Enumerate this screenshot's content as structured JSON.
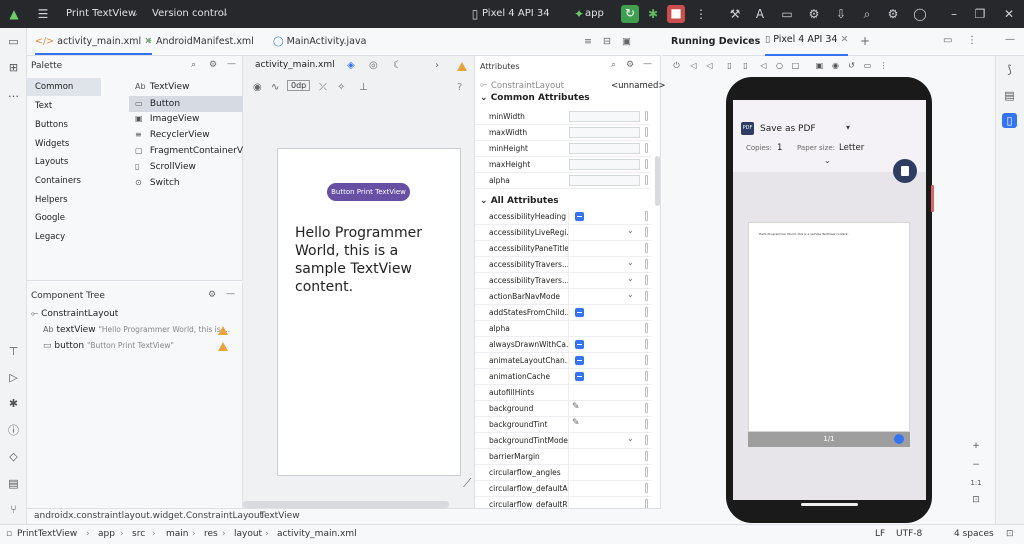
{
  "titlebar": {
    "project": "Print TextView",
    "vcs": "Version control",
    "device": "Pixel 4 API 34",
    "run_config": "app"
  },
  "tabs": [
    {
      "label": "activity_main.xml"
    },
    {
      "label": "AndroidManifest.xml"
    },
    {
      "label": "MainActivity.java"
    }
  ],
  "palette": {
    "title": "Palette",
    "categories": [
      "Common",
      "Text",
      "Buttons",
      "Widgets",
      "Layouts",
      "Containers",
      "Helpers",
      "Google",
      "Legacy"
    ],
    "items": [
      {
        "prefix": "Ab",
        "label": "TextView"
      },
      {
        "prefix": "▭",
        "label": "Button"
      },
      {
        "prefix": "▣",
        "label": "ImageView"
      },
      {
        "prefix": "≡",
        "label": "RecyclerView"
      },
      {
        "prefix": "▢",
        "label": "FragmentContainerView"
      },
      {
        "prefix": "▯",
        "label": "ScrollView"
      },
      {
        "prefix": "⊙",
        "label": "Switch"
      }
    ]
  },
  "component_tree": {
    "title": "Component Tree",
    "root": "ConstraintLayout",
    "children": [
      {
        "prefix": "Ab",
        "id": "textView",
        "hint": "\"Hello Programmer World, this is ..."
      },
      {
        "prefix": "▭",
        "id": "button",
        "hint": "\"Button Print TextView\""
      }
    ]
  },
  "designer": {
    "file": "activity_main.xml",
    "margin": "0dp",
    "button_text": "Button Print TextView",
    "text_content": "Hello Programmer World, this is a sample TextView content."
  },
  "attributes": {
    "title": "Attributes",
    "component": "ConstraintLayout",
    "id_value": "<unnamed>",
    "common_title": "Common Attributes",
    "common": [
      "minWidth",
      "maxWidth",
      "minHeight",
      "maxHeight",
      "alpha"
    ],
    "all_title": "All Attributes",
    "all": [
      {
        "name": "accessibilityHeading",
        "ctl": "flag"
      },
      {
        "name": "accessibilityLiveRegi...",
        "ctl": "chev"
      },
      {
        "name": "accessibilityPaneTitle",
        "ctl": ""
      },
      {
        "name": "accessibilityTravers...",
        "ctl": "chev"
      },
      {
        "name": "accessibilityTravers...",
        "ctl": "chev"
      },
      {
        "name": "actionBarNavMode",
        "ctl": "chev"
      },
      {
        "name": "addStatesFromChild...",
        "ctl": "flag"
      },
      {
        "name": "alpha",
        "ctl": ""
      },
      {
        "name": "alwaysDrawnWithCa...",
        "ctl": "flag"
      },
      {
        "name": "animateLayoutChan...",
        "ctl": "flag"
      },
      {
        "name": "animationCache",
        "ctl": "flag"
      },
      {
        "name": "autofillHints",
        "ctl": ""
      },
      {
        "name": "background",
        "ctl": "edit"
      },
      {
        "name": "backgroundTint",
        "ctl": "edit"
      },
      {
        "name": "backgroundTintMode",
        "ctl": "chev"
      },
      {
        "name": "barrierMargin",
        "ctl": ""
      },
      {
        "name": "circularflow_angles",
        "ctl": ""
      },
      {
        "name": "circularflow_defaultA...",
        "ctl": ""
      },
      {
        "name": "circularflow_defaultR...",
        "ctl": ""
      }
    ]
  },
  "running_devices": {
    "title": "Running Devices",
    "tab": "Pixel 4 API 34",
    "print_title": "Save as PDF",
    "copies_label": "Copies:",
    "copies": "1",
    "paper_label": "Paper size:",
    "paper": "Letter",
    "page_text": "Hello Programmer World, this is a sample TextView content.",
    "page_counter": "1/1",
    "zoom_ratio": "1:1"
  },
  "breadcrumb": {
    "parent": "androidx.constraintlayout.widget.ConstraintLayout",
    "child": "TextView"
  },
  "statusbar": {
    "path": [
      "PrintTextView",
      "app",
      "src",
      "main",
      "res",
      "layout",
      "activity_main.xml"
    ],
    "line_sep": "LF",
    "encoding": "UTF-8",
    "indent": "4 spaces"
  }
}
